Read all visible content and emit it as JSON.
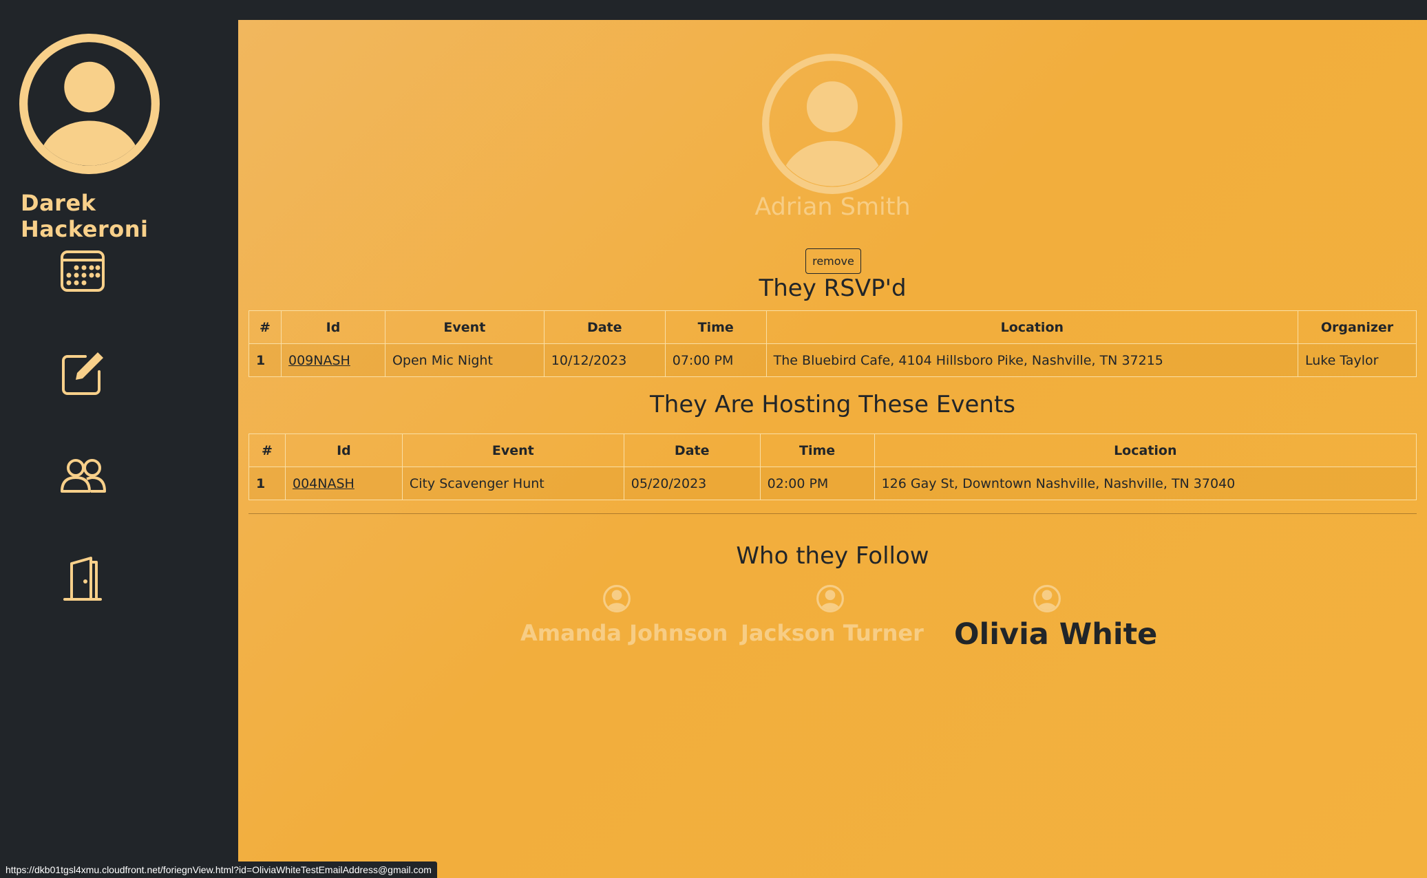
{
  "sidebar": {
    "user_name": "Darek Hackeroni",
    "nav": [
      {
        "icon": "calendar-icon"
      },
      {
        "icon": "edit-icon"
      },
      {
        "icon": "people-icon"
      },
      {
        "icon": "door-icon"
      }
    ]
  },
  "profile": {
    "name": "Adrian Smith",
    "remove_label": "remove"
  },
  "rsvp": {
    "title": "They RSVP'd",
    "headers": [
      "#",
      "Id",
      "Event",
      "Date",
      "Time",
      "Location",
      "Organizer"
    ],
    "rows": [
      [
        "1",
        "009NASH",
        "Open Mic Night",
        "10/12/2023",
        "07:00 PM",
        "The Bluebird Cafe, 4104 Hillsboro Pike, Nashville, TN 37215",
        "Luke Taylor"
      ]
    ]
  },
  "hosting": {
    "title": "They Are Hosting These Events",
    "headers": [
      "#",
      "Id",
      "Event",
      "Date",
      "Time",
      "Location"
    ],
    "rows": [
      [
        "1",
        "004NASH",
        "City Scavenger Hunt",
        "05/20/2023",
        "02:00 PM",
        "126 Gay St, Downtown Nashville, Nashville, TN 37040"
      ]
    ]
  },
  "following": {
    "title": "Who they Follow",
    "people": [
      {
        "name": "Amanda Johnson",
        "hovered": false
      },
      {
        "name": "Jackson Turner",
        "hovered": false
      },
      {
        "name": "Olivia White",
        "hovered": true
      }
    ]
  },
  "status_url": "https://dkb01tgsl4xmu.cloudfront.net/foriegnView.html?id=OliviaWhiteTestEmailAddress@gmail.com",
  "colors": {
    "accent": "#f8d08a",
    "dark": "#212529",
    "background": "#f2ae3d"
  }
}
